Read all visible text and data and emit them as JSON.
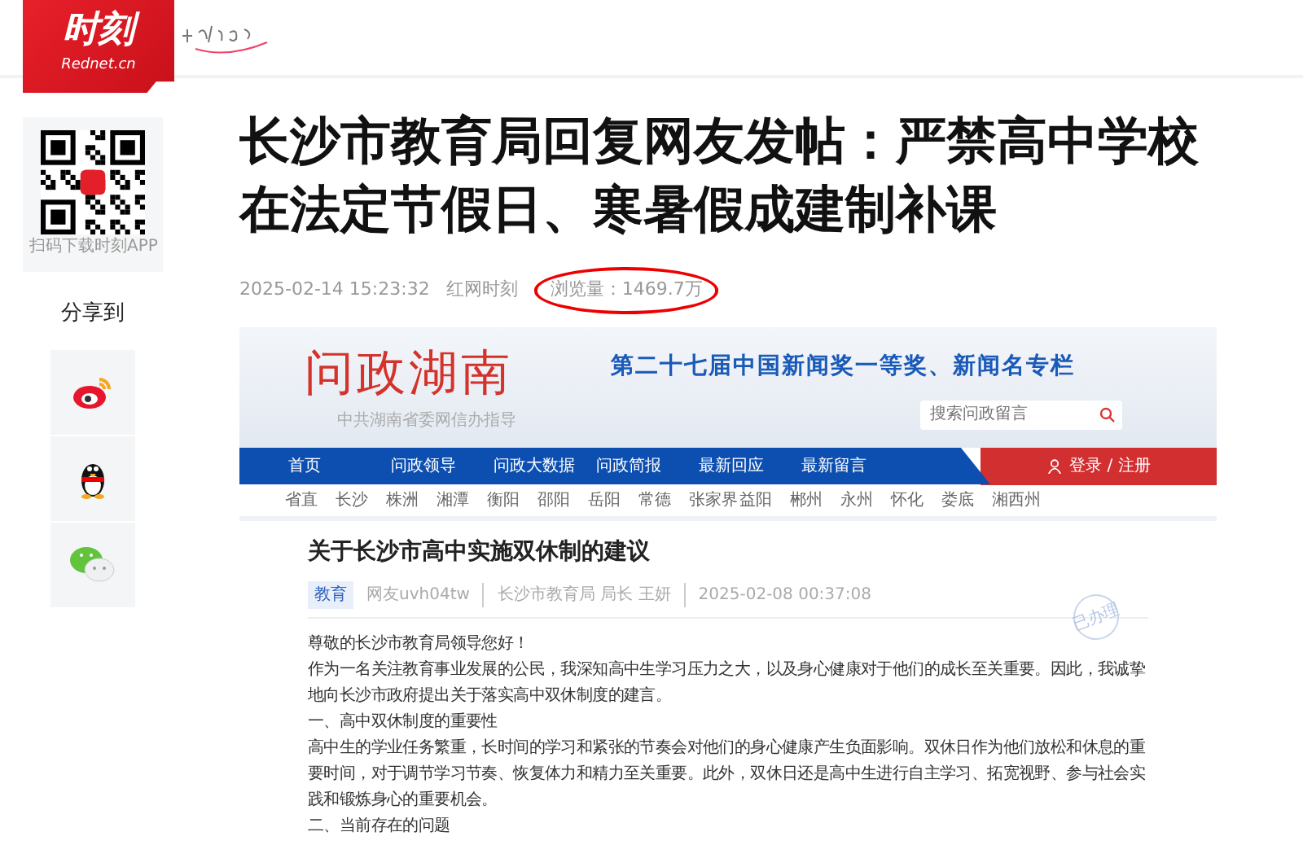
{
  "header": {
    "logo_text": "时刻",
    "logo_sub": "Rednet.cn"
  },
  "sidebar": {
    "qr_caption": "扫码下载时刻APP",
    "share_label": "分享到",
    "share_buttons": [
      {
        "kind": "weibo"
      },
      {
        "kind": "qq"
      },
      {
        "kind": "wechat"
      }
    ]
  },
  "article": {
    "title": "长沙市教育局回复网友发帖：严禁高中学校在法定节假日、寒暑假成建制补课",
    "date": "2025-02-14 15:23:32",
    "source": "红网时刻",
    "views": "浏览量：1469.7万",
    "views_circled": true
  },
  "screenshot": {
    "brand": "问政湖南",
    "brand_sub": "中共湖南省委网信办指导",
    "slogan": "第二十七届中国新闻奖一等奖、新闻名专栏",
    "search": {
      "placeholder": "搜索问政留言"
    },
    "nav": [
      "首页",
      "问政领导",
      "问政大数据",
      "问政简报",
      "最新回应",
      "最新留言"
    ],
    "login": "登录 / 注册",
    "regions": [
      "省直",
      "长沙",
      "株洲",
      "湘潭",
      "衡阳",
      "邵阳",
      "岳阳",
      "常德",
      "张家界",
      "益阳",
      "郴州",
      "永州",
      "怀化",
      "娄底",
      "湘西州"
    ],
    "post_title": "关于长沙市高中实施双休制的建议",
    "tag": "教育",
    "author": "网友uvh04tw",
    "recipient": "长沙市教育局 局长 王妍",
    "time": "2025-02-08 00:37:08",
    "stamp": "已办理",
    "body": [
      "尊敬的长沙市教育局领导您好！",
      "作为一名关注教育事业发展的公民，我深知高中生学习压力之大，以及身心健康对于他们的成长至关重要。因此，我诚挚地向长沙市政府提出关于落实高中双休制度的建言。",
      "一、高中双休制度的重要性",
      "高中生的学业任务繁重，长时间的学习和紧张的节奏会对他们的身心健康产生负面影响。双休日作为他们放松和休息的重要时间，对于调节学习节奏、恢复体力和精力至关重要。此外，双休日还是高中生进行自主学习、拓宽视野、参与社会实践和锻炼身心的重要机会。",
      "二、当前存在的问题"
    ]
  }
}
